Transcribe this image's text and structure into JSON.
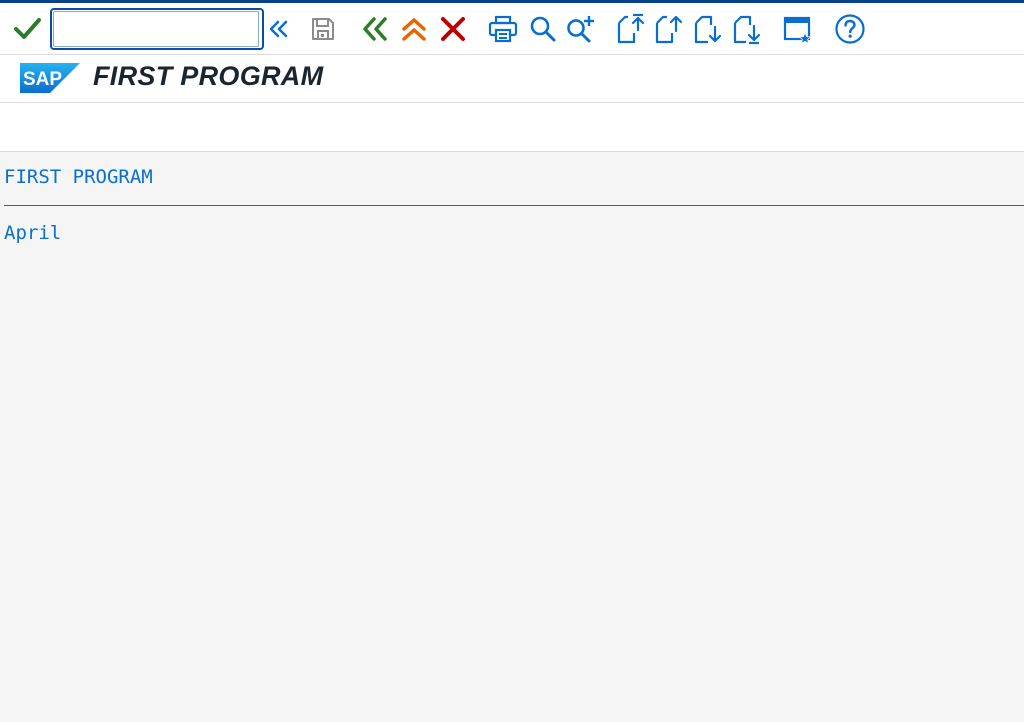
{
  "toolbar": {
    "command_field": {
      "value": "",
      "placeholder": ""
    },
    "icons": {
      "enter": "checkmark-icon",
      "command_toggle": "double-chevron-left-icon",
      "save": "save-icon",
      "back": "back-icon",
      "exit": "exit-icon",
      "cancel": "cancel-icon",
      "print": "print-icon",
      "find": "find-icon",
      "find_next": "find-next-icon",
      "first_page": "first-page-icon",
      "previous_page": "previous-page-icon",
      "next_page": "next-page-icon",
      "last_page": "last-page-icon",
      "customize": "customize-layout-icon",
      "help": "help-icon"
    }
  },
  "titlebar": {
    "logo_text": "SAP",
    "title": "FIRST PROGRAM"
  },
  "list": {
    "header": "FIRST PROGRAM",
    "lines": [
      "April"
    ]
  },
  "colors": {
    "accent_blue": "#0a6ed1",
    "enter_green": "#2b7d2b",
    "back_green": "#2b7d2b",
    "exit_orange": "#e76500",
    "cancel_red": "#bb0000",
    "save_disabled_gray": "#8c8c8c"
  }
}
